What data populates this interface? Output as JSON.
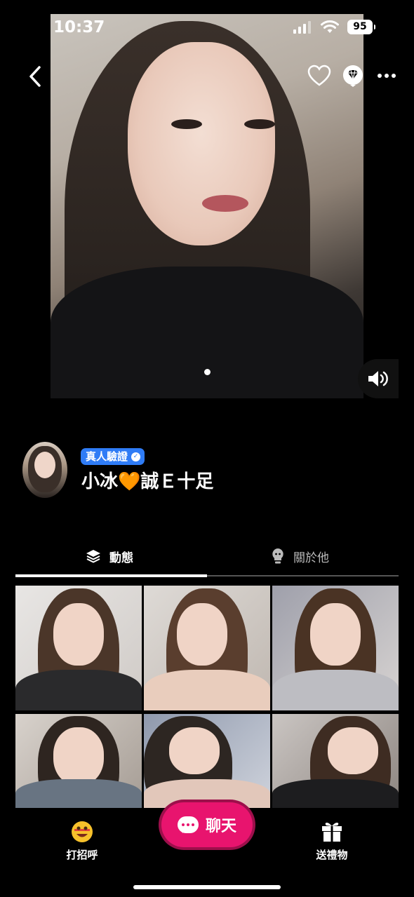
{
  "status_bar": {
    "time": "10:37",
    "battery": "95"
  },
  "hero": {
    "page_index": 1,
    "page_count": 1
  },
  "profile": {
    "verified_badge": "真人驗證",
    "username": "小冰🧡誠Ｅ十足"
  },
  "tabs": [
    {
      "label": "動態",
      "icon": "layers-icon",
      "active": true
    },
    {
      "label": "關於他",
      "icon": "person-bulb-icon",
      "active": false
    }
  ],
  "feed": {
    "photo_count": 6
  },
  "bottom_bar": {
    "greet_label": "打招呼",
    "chat_label": "聊天",
    "gift_label": "送禮物"
  },
  "colors": {
    "accent": "#e8146e",
    "verified": "#2f7cf6",
    "background": "#000000"
  }
}
